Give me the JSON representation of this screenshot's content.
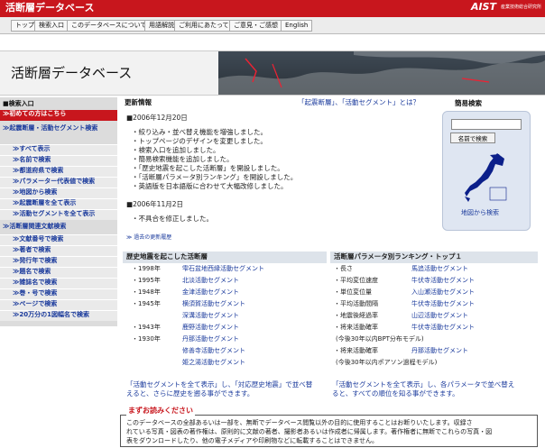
{
  "header": {
    "title": "活断層データベース",
    "org_logo": "AIST",
    "org_name": "産業技術総合研究所"
  },
  "nav": [
    "トップ",
    "検索入口",
    "このデータベースについて",
    "用語解説",
    "ご利用にあたって",
    "ご意見・ご感想",
    "English"
  ],
  "banner": {
    "title": "活断層データベース"
  },
  "sidebar": {
    "heading": "■検索入口",
    "first_time": "≫初めての方はこちら",
    "sections": [
      {
        "label": "≫起震断層・活動セグメント検索",
        "items": [
          "≫すべて表示",
          "≫名前で検索",
          "≫都道府県で検索",
          "≫パラメーター代表値で検索",
          "≫地図から検索",
          "≫起震断層を全て表示",
          "≫活動セグメントを全て表示"
        ]
      },
      {
        "label": "≫活断層関連文献検索",
        "items": [
          "≫文献番号で検索",
          "≫著者で検索",
          "≫発行年で検索",
          "≫題名で検索",
          "≫雑誌名で検索",
          "≫巻・号で検索",
          "≫ページで検索",
          "≫20万分の1図幅名で検索"
        ]
      }
    ]
  },
  "news": {
    "title": "更新情報",
    "links": [
      "「起震断層」、「活動セグメント」とは？"
    ],
    "entries": [
      {
        "date": "■2006年12月20日",
        "items": [
          "・絞り込み・並べ替え機能を増強しました。",
          "・トップページのデザインを変更しました。",
          "・検索入口を追加しました。",
          "・簡易検索機能を追加しました。",
          "・「歴史地震を起こした活断層」を開設しました。",
          "・「活断層パラメータ別ランキング」を開設しました。",
          "・英語版を日本語版に合わせて大幅改修しました。"
        ]
      },
      {
        "date": "■2006年11月2日",
        "items": [
          "・不具合を修正しました。"
        ]
      }
    ],
    "past_link": "≫ 過去の更新履歴"
  },
  "quick_search": {
    "title": "簡易検索",
    "input_value": "",
    "button": "名前で検索",
    "map_link": "地図から検索"
  },
  "historic": {
    "title": "歴史地震を起こした活断層",
    "rows": [
      {
        "year": "・1998年",
        "name": "雫石盆地西縁活動セグメント"
      },
      {
        "year": "・1995年",
        "name": "北淡活動セグメント"
      },
      {
        "year": "・1948年",
        "name": "金津活動セグメント"
      },
      {
        "year": "・1945年",
        "name": "横須賀活動セグメント"
      },
      {
        "year": "",
        "name": "深溝活動セグメント"
      },
      {
        "year": "・1943年",
        "name": "鹿野活動セグメント"
      },
      {
        "year": "・1930年",
        "name": "丹那活動セグメント"
      },
      {
        "year": "",
        "name": "修善寺活動セグメント"
      },
      {
        "year": "",
        "name": "姫之湯活動セグメント"
      }
    ],
    "footer": [
      "「活動セグメントを全て表示」し、「対応歴史地震」で並べ替",
      "えると、さらに歴史を遡る事ができます。"
    ]
  },
  "ranking": {
    "title": "活断層パラメータ別ランキング・トップ１",
    "rows": [
      {
        "param": "・長さ",
        "name": "馬追活動セグメント",
        "note": ""
      },
      {
        "param": "・平均変位速度",
        "name": "牛伏寺活動セグメント",
        "note": ""
      },
      {
        "param": "・単位変位量",
        "name": "入山瀬活動セグメント",
        "note": ""
      },
      {
        "param": "・平均活動間隔",
        "name": "牛伏寺活動セグメント",
        "note": ""
      },
      {
        "param": "・地震後経過率",
        "name": "山辺活動セグメント",
        "note": ""
      },
      {
        "param": "・将来活動確率",
        "name": "牛伏寺活動セグメント",
        "note": ""
      },
      {
        "param": "",
        "name": "",
        "note": "(今後30年以内BPT分布モデル)"
      },
      {
        "param": "・将来活動確率",
        "name": "丹那活動セグメント",
        "note": ""
      },
      {
        "param": "",
        "name": "",
        "note": "(今後30年以内ポアソン過程モデル)"
      }
    ],
    "footer": [
      "「活動セグメントを全て表示」し、各パラメータで並べ替え",
      "ると、すべての順位を知る事ができます。"
    ]
  },
  "warning": {
    "title": "まずお読みください",
    "lines": [
      "このデータベースの全部あるいは一部を、無断でデータベース閲覧以外の目的に使用することはお断りいたします。収録さ",
      "れている写真・図表の著作権は、原則的に文献の著者、撮影者あるいは作成者に帰属します。著作権者に無断でこれらの写真・図",
      "表をダウンロードしたり、他の電子メディアや印刷物などに転載することはできません。"
    ]
  },
  "colors": {
    "brand_red": "#c8161d",
    "link": "#1a3a9c",
    "sidebar_bg": "#dcdcdc"
  }
}
